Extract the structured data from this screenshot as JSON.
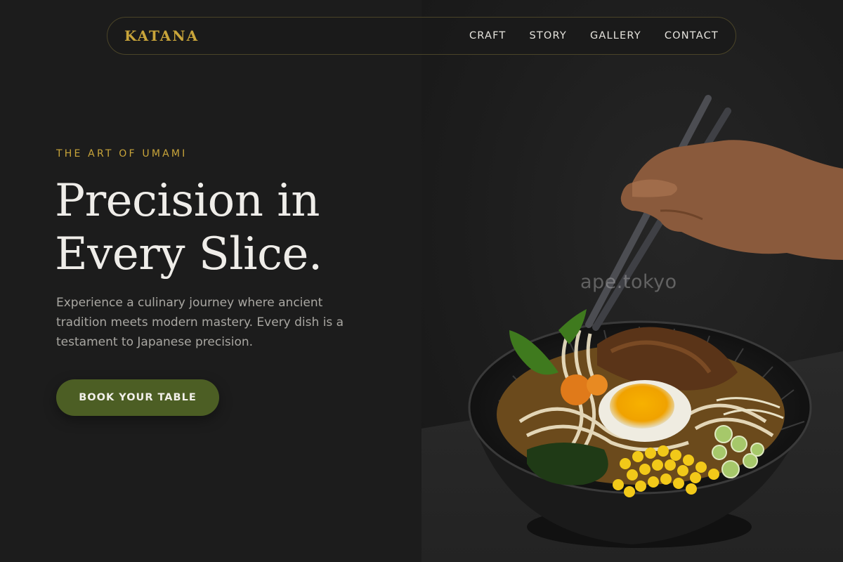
{
  "nav": {
    "brand": "KATANA",
    "links": [
      "CRAFT",
      "STORY",
      "GALLERY",
      "CONTACT"
    ]
  },
  "hero": {
    "eyebrow": "THE ART OF UMAMI",
    "headline_line1": "Precision in",
    "headline_line2": "Every Slice.",
    "subtext": "Experience a culinary journey where ancient tradition meets modern mastery. Every dish is a testament to Japanese precision.",
    "cta_label": "BOOK YOUR TABLE"
  },
  "image": {
    "watermark": "ape.tokyo"
  },
  "colors": {
    "accent_gold": "#c9a53a",
    "cta_green": "#4c5e24",
    "background": "#1c1c1c"
  }
}
